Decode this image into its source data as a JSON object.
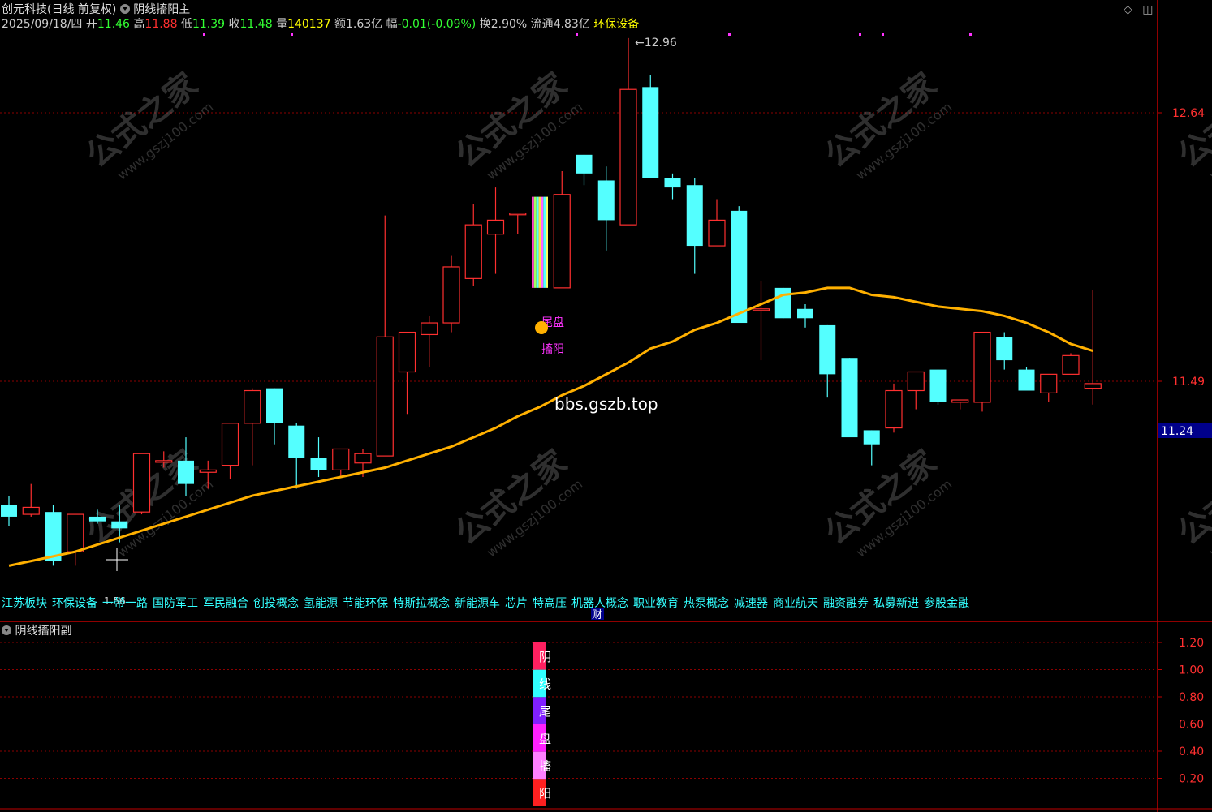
{
  "header": {
    "stock_name": "创元科技(日线 前复权)",
    "indicator_main": "阴线搐阳主",
    "date": "2025/09/18/四",
    "open_label": "开",
    "open": "11.46",
    "high_label": "高",
    "high": "11.88",
    "low_label": "低",
    "low": "11.39",
    "close_label": "收",
    "close": "11.48",
    "volume_label": "量",
    "volume": "140137",
    "amount_label": "额",
    "amount": "1.63亿",
    "change_label": "幅",
    "change": "-0.01(-0.09%)",
    "turnover_label": "换",
    "turnover": "2.90%",
    "float_label": "流通",
    "float_cap": "4.83亿",
    "sector": "环保设备"
  },
  "sub_indicator": "阴线搐阳副",
  "concepts": [
    "江苏板块",
    "环保设备",
    "一带一路",
    "国防军工",
    "军民融合",
    "创投概念",
    "氢能源",
    "节能环保",
    "特斯拉概念",
    "新能源车",
    "芯片",
    "特高压",
    "机器人概念",
    "职业教育",
    "热泵概念",
    "减速器",
    "商业航天",
    "融资融券",
    "私募新进",
    "参股金融"
  ],
  "cai_label": "财",
  "watermark": {
    "cn": "公式之家",
    "url": "www.gszj100.com",
    "site": "bbs.gszb.top"
  },
  "signal_labels": {
    "tail": "尾盘",
    "yang": "搐阳"
  },
  "vertical_labels": [
    "阴",
    "线",
    "尾",
    "盘",
    "搐",
    "阳"
  ],
  "current_price_tag": "11.24",
  "low_marker": "1.56",
  "colors": {
    "up": "#ff3030",
    "down": "#54ffff",
    "ma": "#ffb000",
    "grid": "#8b0000",
    "axis": "#c00000",
    "magenta": "#ff33ff"
  },
  "chart_data": {
    "type": "candlestick",
    "price_axis": {
      "ticks": [
        12.64,
        11.49
      ],
      "ylim": [
        10.28,
        13.14
      ]
    },
    "max_annotation": "12.96",
    "candles": [
      {
        "o": 10.96,
        "h": 11.0,
        "l": 10.87,
        "c": 10.91
      },
      {
        "o": 10.92,
        "h": 11.05,
        "l": 10.91,
        "c": 10.95
      },
      {
        "o": 10.93,
        "h": 10.96,
        "l": 10.7,
        "c": 10.72
      },
      {
        "o": 10.76,
        "h": 10.92,
        "l": 10.7,
        "c": 10.92
      },
      {
        "o": 10.91,
        "h": 10.94,
        "l": 10.88,
        "c": 10.89
      },
      {
        "o": 10.89,
        "h": 10.96,
        "l": 10.8,
        "c": 10.86
      },
      {
        "o": 10.93,
        "h": 11.18,
        "l": 10.92,
        "c": 11.18
      },
      {
        "o": 11.15,
        "h": 11.19,
        "l": 11.12,
        "c": 11.15
      },
      {
        "o": 11.15,
        "h": 11.25,
        "l": 11.0,
        "c": 11.05
      },
      {
        "o": 11.1,
        "h": 11.15,
        "l": 11.03,
        "c": 11.11
      },
      {
        "o": 11.13,
        "h": 11.31,
        "l": 11.07,
        "c": 11.31
      },
      {
        "o": 11.31,
        "h": 11.46,
        "l": 11.13,
        "c": 11.45
      },
      {
        "o": 11.46,
        "h": 11.46,
        "l": 11.22,
        "c": 11.31
      },
      {
        "o": 11.3,
        "h": 11.31,
        "l": 11.03,
        "c": 11.16
      },
      {
        "o": 11.16,
        "h": 11.25,
        "l": 11.08,
        "c": 11.11
      },
      {
        "o": 11.11,
        "h": 11.2,
        "l": 11.08,
        "c": 11.2
      },
      {
        "o": 11.14,
        "h": 11.2,
        "l": 11.08,
        "c": 11.18
      },
      {
        "o": 11.17,
        "h": 12.2,
        "l": 11.17,
        "c": 11.68
      },
      {
        "o": 11.53,
        "h": 11.7,
        "l": 11.35,
        "c": 11.7
      },
      {
        "o": 11.69,
        "h": 11.77,
        "l": 11.55,
        "c": 11.74
      },
      {
        "o": 11.74,
        "h": 12.03,
        "l": 11.7,
        "c": 11.98
      },
      {
        "o": 11.93,
        "h": 12.25,
        "l": 11.9,
        "c": 12.16
      },
      {
        "o": 12.12,
        "h": 12.32,
        "l": 11.95,
        "c": 12.18
      },
      {
        "o": 12.21,
        "h": 12.21,
        "l": 12.12,
        "c": 12.21
      },
      {
        "o": 12.28,
        "h": 12.28,
        "l": 11.89,
        "c": 11.89
      },
      {
        "o": 11.89,
        "h": 12.39,
        "l": 11.89,
        "c": 12.29
      },
      {
        "o": 12.46,
        "h": 12.46,
        "l": 12.33,
        "c": 12.38
      },
      {
        "o": 12.35,
        "h": 12.41,
        "l": 12.05,
        "c": 12.18
      },
      {
        "o": 12.16,
        "h": 12.96,
        "l": 12.16,
        "c": 12.74
      },
      {
        "o": 12.75,
        "h": 12.8,
        "l": 12.39,
        "c": 12.36
      },
      {
        "o": 12.36,
        "h": 12.38,
        "l": 12.27,
        "c": 12.32
      },
      {
        "o": 12.33,
        "h": 12.36,
        "l": 11.95,
        "c": 12.07
      },
      {
        "o": 12.07,
        "h": 12.27,
        "l": 12.08,
        "c": 12.18
      },
      {
        "o": 12.22,
        "h": 12.24,
        "l": 11.74,
        "c": 11.74
      },
      {
        "o": 11.8,
        "h": 11.92,
        "l": 11.58,
        "c": 11.8
      },
      {
        "o": 11.89,
        "h": 11.89,
        "l": 11.76,
        "c": 11.76
      },
      {
        "o": 11.8,
        "h": 11.82,
        "l": 11.72,
        "c": 11.76
      },
      {
        "o": 11.73,
        "h": 11.73,
        "l": 11.42,
        "c": 11.52
      },
      {
        "o": 11.59,
        "h": 11.59,
        "l": 11.32,
        "c": 11.25
      },
      {
        "o": 11.28,
        "h": 11.28,
        "l": 11.13,
        "c": 11.22
      },
      {
        "o": 11.29,
        "h": 11.48,
        "l": 11.27,
        "c": 11.45
      },
      {
        "o": 11.45,
        "h": 11.53,
        "l": 11.37,
        "c": 11.53
      },
      {
        "o": 11.54,
        "h": 11.54,
        "l": 11.39,
        "c": 11.4
      },
      {
        "o": 11.4,
        "h": 11.41,
        "l": 11.37,
        "c": 11.41
      },
      {
        "o": 11.4,
        "h": 11.7,
        "l": 11.36,
        "c": 11.7
      },
      {
        "o": 11.68,
        "h": 11.7,
        "l": 11.54,
        "c": 11.58
      },
      {
        "o": 11.54,
        "h": 11.55,
        "l": 11.45,
        "c": 11.45
      },
      {
        "o": 11.44,
        "h": 11.52,
        "l": 11.4,
        "c": 11.52
      },
      {
        "o": 11.52,
        "h": 11.61,
        "l": 11.52,
        "c": 11.6
      },
      {
        "o": 11.46,
        "h": 11.88,
        "l": 11.39,
        "c": 11.48
      }
    ],
    "ma": [
      10.7,
      10.72,
      10.74,
      10.76,
      10.79,
      10.82,
      10.85,
      10.88,
      10.91,
      10.94,
      10.97,
      11.0,
      11.02,
      11.04,
      11.06,
      11.08,
      11.1,
      11.12,
      11.15,
      11.18,
      11.21,
      11.25,
      11.29,
      11.34,
      11.38,
      11.43,
      11.47,
      11.52,
      11.57,
      11.63,
      11.66,
      11.71,
      11.74,
      11.78,
      11.82,
      11.86,
      11.87,
      11.89,
      11.89,
      11.86,
      11.85,
      11.83,
      11.81,
      11.8,
      11.79,
      11.77,
      11.74,
      11.7,
      11.65,
      11.62
    ],
    "signal_index": 24,
    "sub_axis": {
      "ticks": [
        1.2,
        1.0,
        0.8,
        0.6,
        0.4,
        0.2
      ],
      "ylim": [
        0,
        1.4
      ]
    }
  }
}
